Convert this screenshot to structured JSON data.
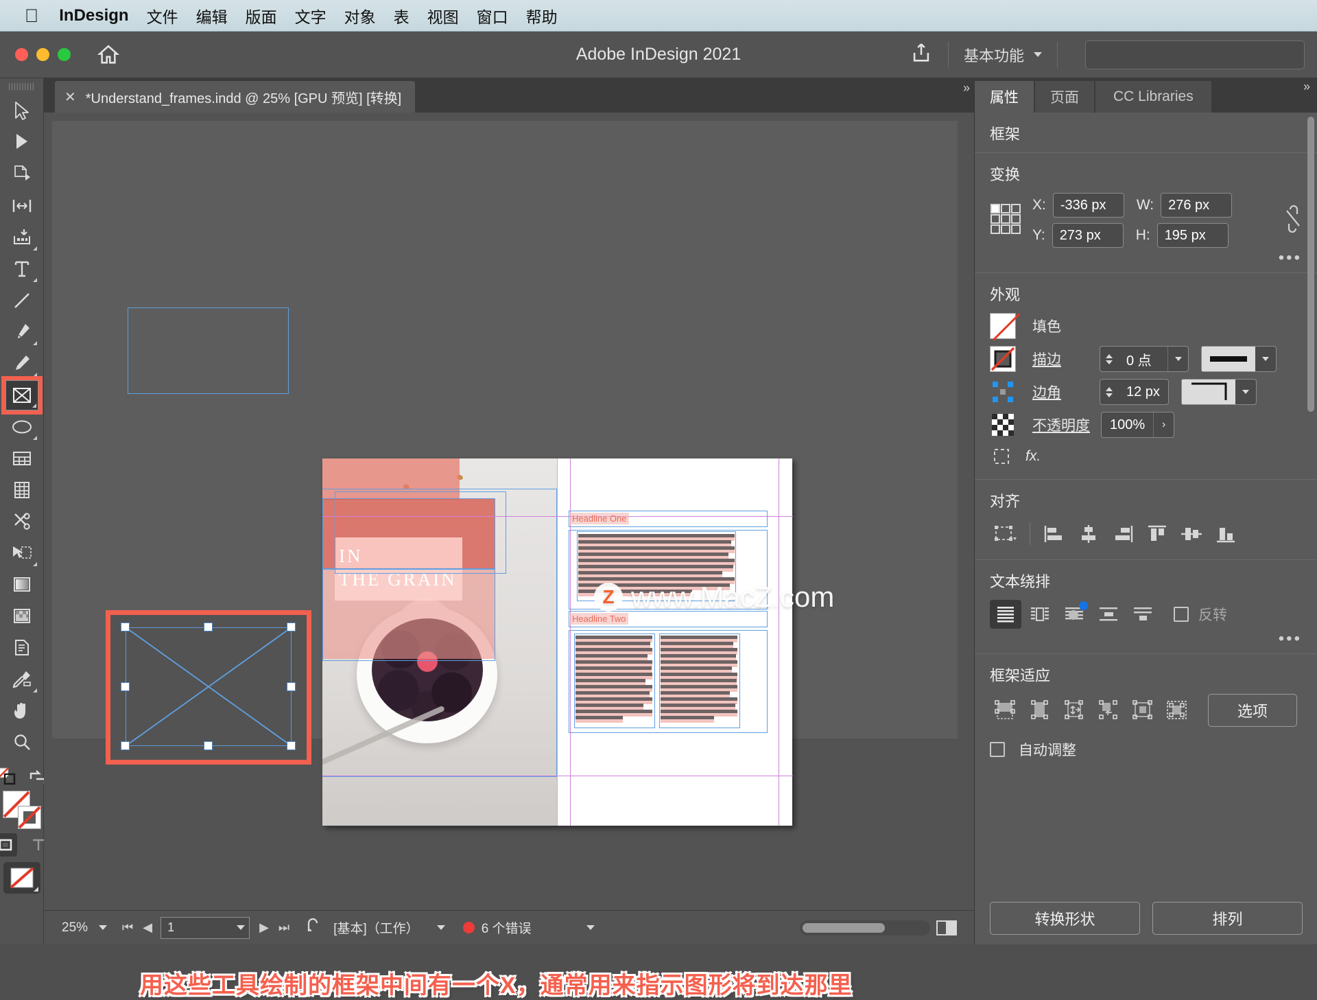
{
  "menubar": {
    "apple_icon": "apple-logo-icon",
    "app_name": "InDesign",
    "items": [
      "文件",
      "编辑",
      "版面",
      "文字",
      "对象",
      "表",
      "视图",
      "窗口",
      "帮助"
    ]
  },
  "titlebar": {
    "title": "Adobe InDesign 2021",
    "home_icon": "home-icon",
    "share_icon": "share-icon",
    "workspace": "基本功能",
    "search_placeholder": ""
  },
  "document_tab": {
    "close_icon": "close-icon",
    "label": "*Understand_frames.indd @ 25% [GPU 预览] [转换]"
  },
  "toolbar": {
    "tools": [
      {
        "name": "selection-tool",
        "icon": "arrow-cursor-icon"
      },
      {
        "name": "direct-selection-tool",
        "icon": "white-arrow-icon"
      },
      {
        "name": "page-tool",
        "icon": "page-icon"
      },
      {
        "name": "gap-tool",
        "icon": "gap-icon"
      },
      {
        "name": "content-collector-tool",
        "icon": "content-collector-icon"
      },
      {
        "name": "type-tool",
        "icon": "type-T-icon"
      },
      {
        "name": "line-tool",
        "icon": "line-icon"
      },
      {
        "name": "pen-tool",
        "icon": "pen-nib-icon"
      },
      {
        "name": "pencil-tool",
        "icon": "pencil-icon"
      },
      {
        "name": "rectangle-frame-tool",
        "icon": "rectangle-frame-x-icon"
      },
      {
        "name": "ellipse-tool",
        "icon": "ellipse-icon"
      },
      {
        "name": "free-transform-tool",
        "icon": "table-icon"
      },
      {
        "name": "column-tool",
        "icon": "columns-icon"
      },
      {
        "name": "scissors-tool",
        "icon": "scissors-icon"
      },
      {
        "name": "transform-tool",
        "icon": "free-transform-icon"
      },
      {
        "name": "gradient-swatch-tool",
        "icon": "gradient-icon"
      },
      {
        "name": "gradient-feather-tool",
        "icon": "gradient-feather-icon"
      },
      {
        "name": "note-tool",
        "icon": "note-icon"
      },
      {
        "name": "eyedropper-tool",
        "icon": "eyedropper-icon"
      },
      {
        "name": "hand-tool",
        "icon": "hand-icon"
      },
      {
        "name": "zoom-tool",
        "icon": "magnifier-icon"
      }
    ],
    "fill_stroke": {
      "swap_icon": "swap-fill-stroke-icon",
      "default_icon": "default-fill-stroke-icon",
      "fill_label": "none",
      "stroke_label": "none",
      "format_frame_icon": "format-frame-icon",
      "format_text_icon": "format-text-T-icon",
      "apply_none_icon": "apply-none-icon"
    }
  },
  "canvas": {
    "empty_frame_name": "empty-text-frame",
    "selected_frame_name": "selected-graphic-frame",
    "spread": {
      "cover_title": "IN\nTHE GRAIN",
      "cover_title_line1": "IN",
      "cover_title_line2": "THE GRAIN",
      "headline_one": "Headline One",
      "headline_two": "Headline Two"
    },
    "watermark": {
      "logo_letter": "Z",
      "text": "www.MacZ.com"
    },
    "annotation": "用这些工具绘制的框架中间有一个X，通常用来指示图形将到达那里"
  },
  "statusbar": {
    "zoom": "25%",
    "page": "1",
    "preflight_icon": "preflight-icon",
    "profile": "[基本]（工作）",
    "error_text": "6 个错误",
    "error_color": "#ef3b39",
    "first_page_icon": "first-page-icon",
    "prev_page_icon": "prev-page-icon",
    "next_page_icon": "next-page-icon",
    "last_page_icon": "last-page-icon",
    "view_mode_icon": "view-mode-icon"
  },
  "properties_panel": {
    "tabs": [
      {
        "label": "属性",
        "active": true
      },
      {
        "label": "页面",
        "active": false
      },
      {
        "label": "CC Libraries",
        "active": false
      }
    ],
    "object_type": "框架",
    "transform": {
      "title": "变换",
      "reference_point_icon": "reference-point-grid-icon",
      "x_label": "X:",
      "x_value": "-336 px",
      "y_label": "Y:",
      "y_value": "273 px",
      "w_label": "W:",
      "w_value": "276 px",
      "h_label": "H:",
      "h_value": "195 px",
      "constrain_icon": "broken-chain-icon",
      "more_icon": "more-options-icon"
    },
    "appearance": {
      "title": "外观",
      "fill_label": "填色",
      "fill_icon": "fill-none-swatch-icon",
      "stroke_label": "描边",
      "stroke_icon": "stroke-none-swatch-icon",
      "stroke_weight": "0 点",
      "stroke_style_icon": "solid-line-icon",
      "corner_label": "边角",
      "corner_icon": "corner-options-icon",
      "corner_value": "12 px",
      "corner_style_icon": "corner-shape-icon",
      "opacity_label": "不透明度",
      "opacity_icon": "opacity-checker-icon",
      "opacity_value": "100%",
      "effects_icon": "effects-fx-icon",
      "fx_label": "fx."
    },
    "align": {
      "title": "对齐",
      "align_to_icon": "align-to-selection-icon",
      "buttons": [
        "align-left-icon",
        "align-horizontal-center-icon",
        "align-right-icon",
        "align-top-icon",
        "align-vertical-center-icon",
        "align-bottom-icon"
      ]
    },
    "text_wrap": {
      "title": "文本绕排",
      "buttons": [
        "wrap-none-icon",
        "wrap-bounding-box-icon",
        "wrap-object-shape-icon",
        "wrap-jump-object-icon",
        "wrap-jump-next-column-icon"
      ],
      "active_index": 0,
      "invert_label": "反转",
      "more_icon": "more-options-icon"
    },
    "frame_fitting": {
      "title": "框架适应",
      "buttons": [
        "fit-content-to-frame-icon",
        "fit-frame-to-content-icon",
        "fill-frame-proportionally-icon",
        "fit-content-proportionally-icon",
        "center-content-icon",
        "clear-frame-fitting-icon"
      ],
      "options_label": "选项",
      "auto_fit_label": "自动调整",
      "auto_fit_checked": false
    },
    "footer_buttons": [
      {
        "label": "转换形状"
      },
      {
        "label": "排列"
      }
    ]
  },
  "colors": {
    "accent_red": "#f2604f",
    "frame_blue": "#5f9fe0",
    "margin_magenta": "#cf7fdc",
    "panel_bg": "#5a5a5a",
    "chrome_bg": "#535353",
    "error_red": "#ef3b39"
  }
}
